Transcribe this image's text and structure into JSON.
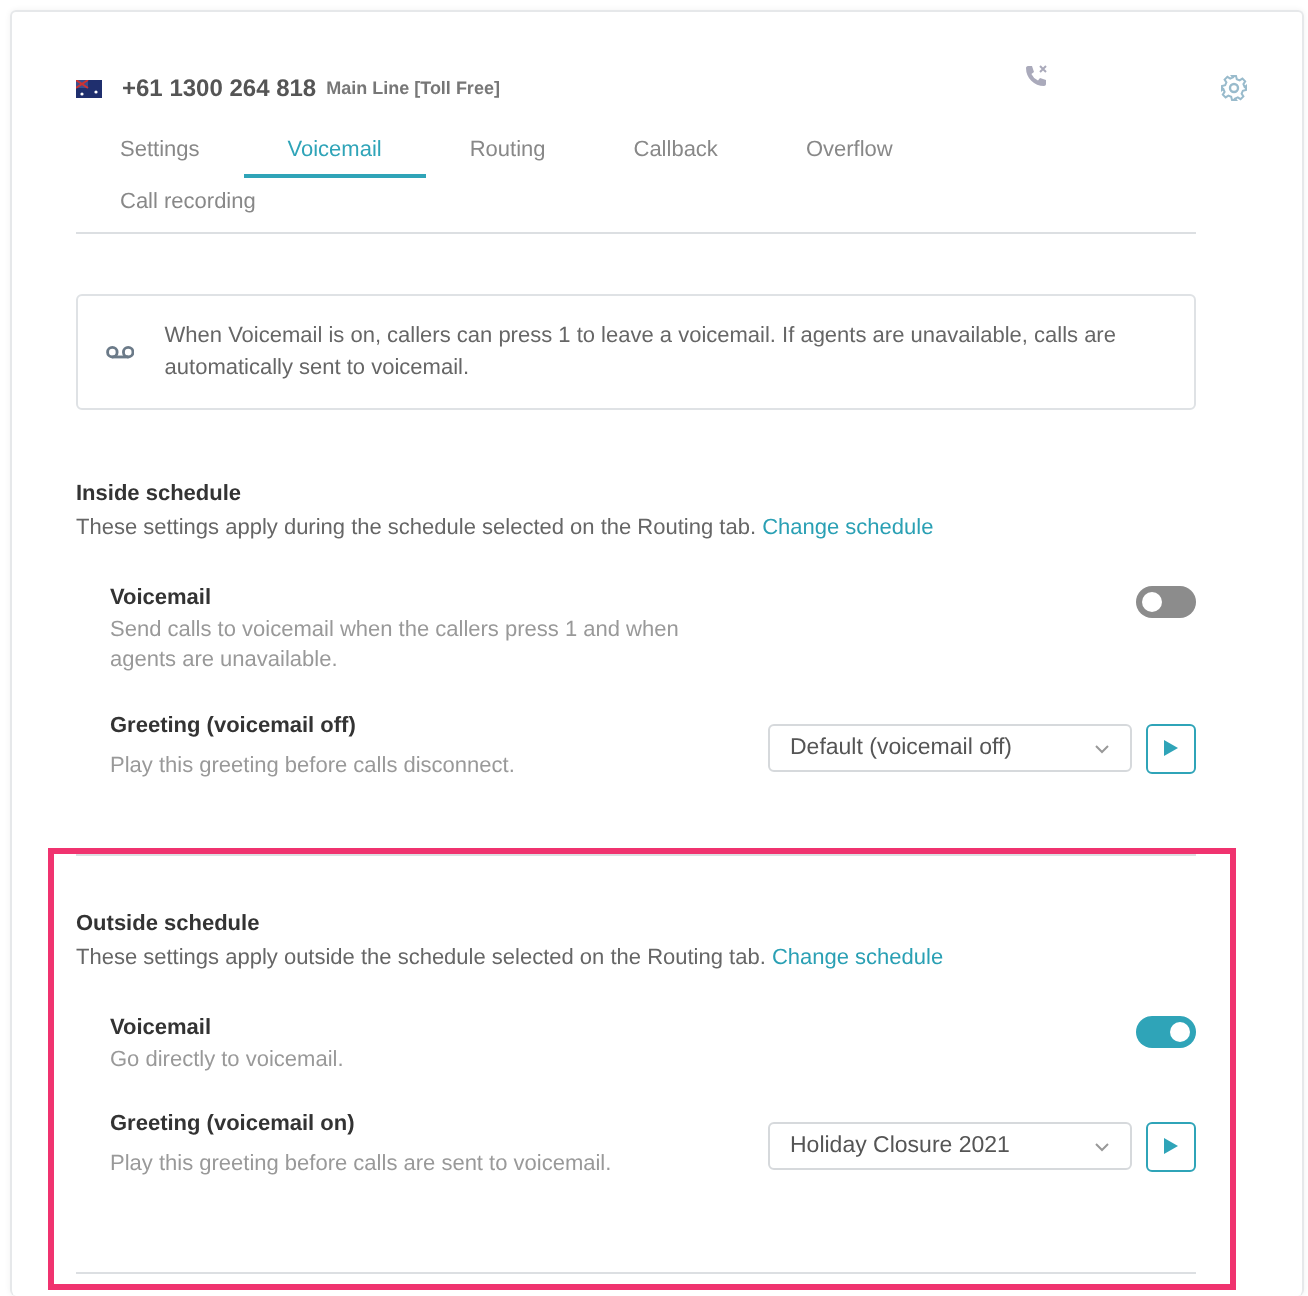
{
  "header": {
    "phone_number": "+61 1300 264 818",
    "line_name": "Main Line [Toll Free]"
  },
  "tabs": [
    {
      "label": "Settings",
      "selected": false
    },
    {
      "label": "Voicemail",
      "selected": true
    },
    {
      "label": "Routing",
      "selected": false
    },
    {
      "label": "Callback",
      "selected": false
    },
    {
      "label": "Overflow",
      "selected": false
    },
    {
      "label": "Call recording",
      "selected": false
    }
  ],
  "info": "When Voicemail is on, callers can press 1 to leave a voicemail. If agents are unavailable, calls are automatically sent to voicemail.",
  "sections": [
    {
      "title": "Inside schedule",
      "description": "These settings apply during the schedule selected on the Routing tab.",
      "link": "Change schedule",
      "highlighted": false,
      "voicemail": {
        "label": "Voicemail",
        "description": "Send calls to voicemail when the callers press 1 and when agents are unavailable.",
        "on": false
      },
      "greeting": {
        "label": "Greeting (voicemail off)",
        "description": "Play this greeting before calls disconnect.",
        "value": "Default (voicemail off)"
      }
    },
    {
      "title": "Outside schedule",
      "description": "These settings apply outside the schedule selected on the Routing tab.",
      "link": "Change schedule",
      "highlighted": true,
      "voicemail": {
        "label": "Voicemail",
        "description": "Go directly to voicemail.",
        "on": true
      },
      "greeting": {
        "label": "Greeting (voicemail on)",
        "description": "Play this greeting before calls are sent to voicemail.",
        "value": "Holiday Closure 2021"
      }
    }
  ]
}
